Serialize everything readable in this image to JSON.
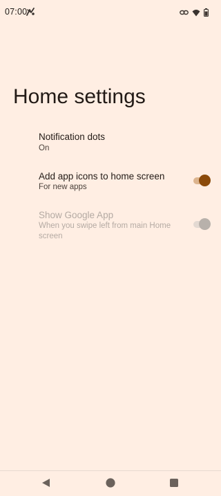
{
  "status_bar": {
    "time": "07:00",
    "left_icon": "signal-tower-icon",
    "right_icons": [
      "link-icon",
      "wifi-icon",
      "battery-icon"
    ]
  },
  "page": {
    "title": "Home settings"
  },
  "settings": [
    {
      "title": "Notification dots",
      "summary": "On",
      "has_toggle": false,
      "enabled": true
    },
    {
      "title": "Add app icons to home screen",
      "summary": "For new apps",
      "has_toggle": true,
      "toggle_on": true,
      "enabled": true
    },
    {
      "title": "Show Google App",
      "summary": "When you swipe left from main Home screen",
      "has_toggle": true,
      "toggle_on": true,
      "enabled": false
    }
  ],
  "nav_bar": {
    "buttons": [
      "back-icon",
      "home-icon",
      "recents-icon"
    ]
  },
  "colors": {
    "background": "#FFEEE3",
    "accent": "#8B4A0A",
    "accent_track": "#DCB48E",
    "disabled_text": "#B4AAA3"
  }
}
